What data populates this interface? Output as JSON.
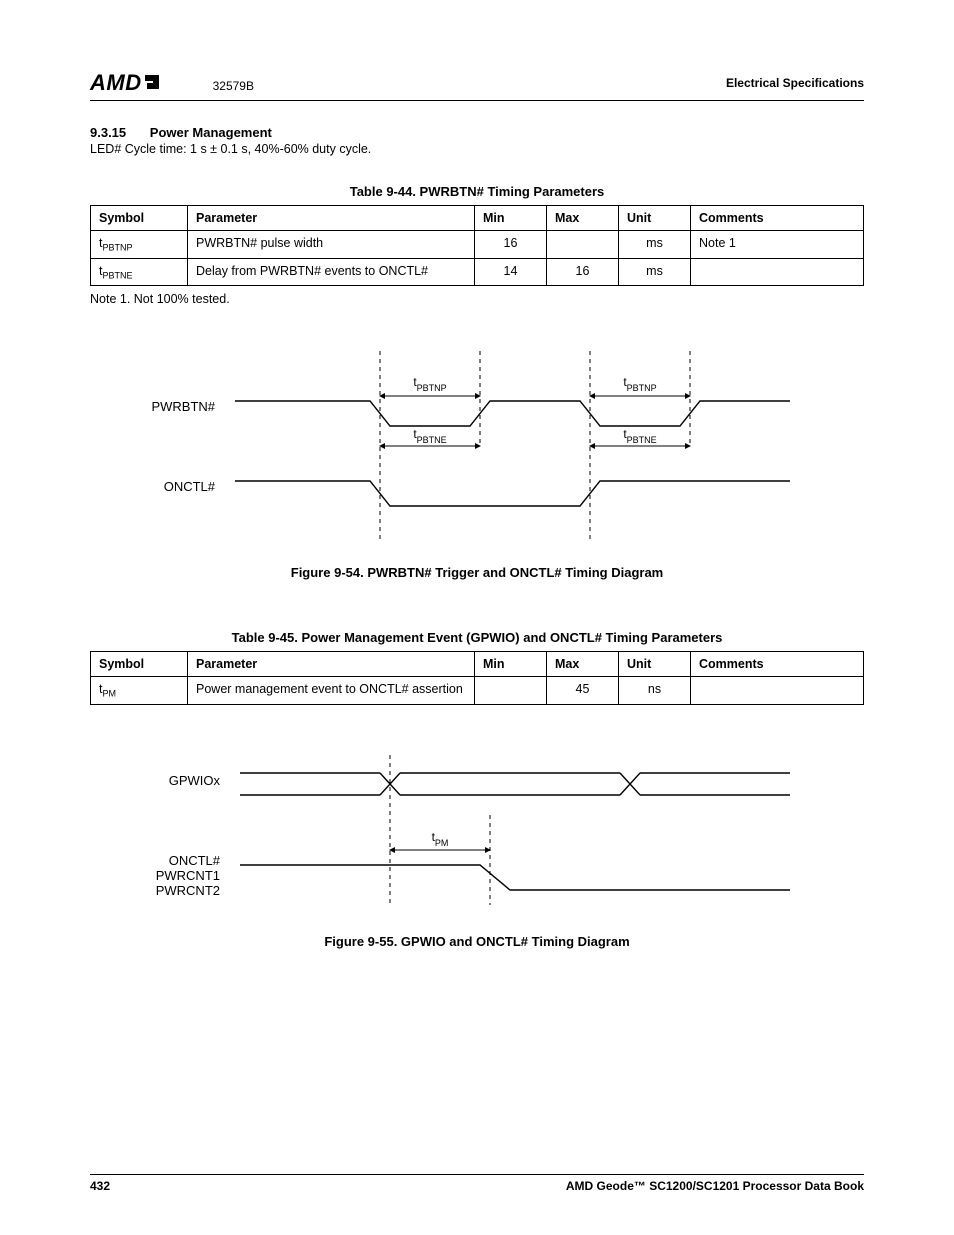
{
  "header": {
    "logo": "AMD",
    "docnum": "32579B",
    "rightspec": "Electrical Specifications"
  },
  "section": {
    "num": "9.3.15",
    "title": "Power Management",
    "body": "LED# Cycle time: 1 s ± 0.1 s, 40%-60% duty cycle."
  },
  "table44": {
    "caption": "Table 9-44.  PWRBTN# Timing Parameters",
    "headers": [
      "Symbol",
      "Parameter",
      "Min",
      "Max",
      "Unit",
      "Comments"
    ],
    "rows": [
      {
        "symbol_pre": "t",
        "symbol_sub": "PBTNP",
        "param": "PWRBTN# pulse width",
        "min": "16",
        "max": "",
        "unit": "ms",
        "comments": "Note 1"
      },
      {
        "symbol_pre": "t",
        "symbol_sub": "PBTNE",
        "param": "Delay from PWRBTN# events to ONCTL#",
        "min": "14",
        "max": "16",
        "unit": "ms",
        "comments": ""
      }
    ],
    "note": "Note 1.   Not 100% tested."
  },
  "figure54": {
    "caption": "Figure 9-54.  PWRBTN# Trigger and ONCTL# Timing Diagram",
    "labels": {
      "sigA": "PWRBTN#",
      "sigB": "ONCTL#",
      "t_up_pre": "t",
      "t_up_sub": "PBTNP",
      "t_lo_pre": "t",
      "t_lo_sub": "PBTNE"
    }
  },
  "table45": {
    "caption": "Table 9-45.  Power Management Event (GPWIO) and ONCTL# Timing Parameters",
    "headers": [
      "Symbol",
      "Parameter",
      "Min",
      "Max",
      "Unit",
      "Comments"
    ],
    "rows": [
      {
        "symbol_pre": "t",
        "symbol_sub": "PM",
        "param": "Power management event to ONCTL# assertion",
        "min": "",
        "max": "45",
        "unit": "ns",
        "comments": ""
      }
    ]
  },
  "figure55": {
    "caption": "Figure 9-55.  GPWIO and ONCTL# Timing Diagram",
    "labels": {
      "sigA": "GPWIOx",
      "sigB1": "ONCTL#",
      "sigB2": "PWRCNT1",
      "sigB3": "PWRCNT2",
      "t_pre": "t",
      "t_sub": "PM"
    }
  },
  "footer": {
    "page": "432",
    "book": "AMD Geode™ SC1200/SC1201 Processor Data Book"
  }
}
